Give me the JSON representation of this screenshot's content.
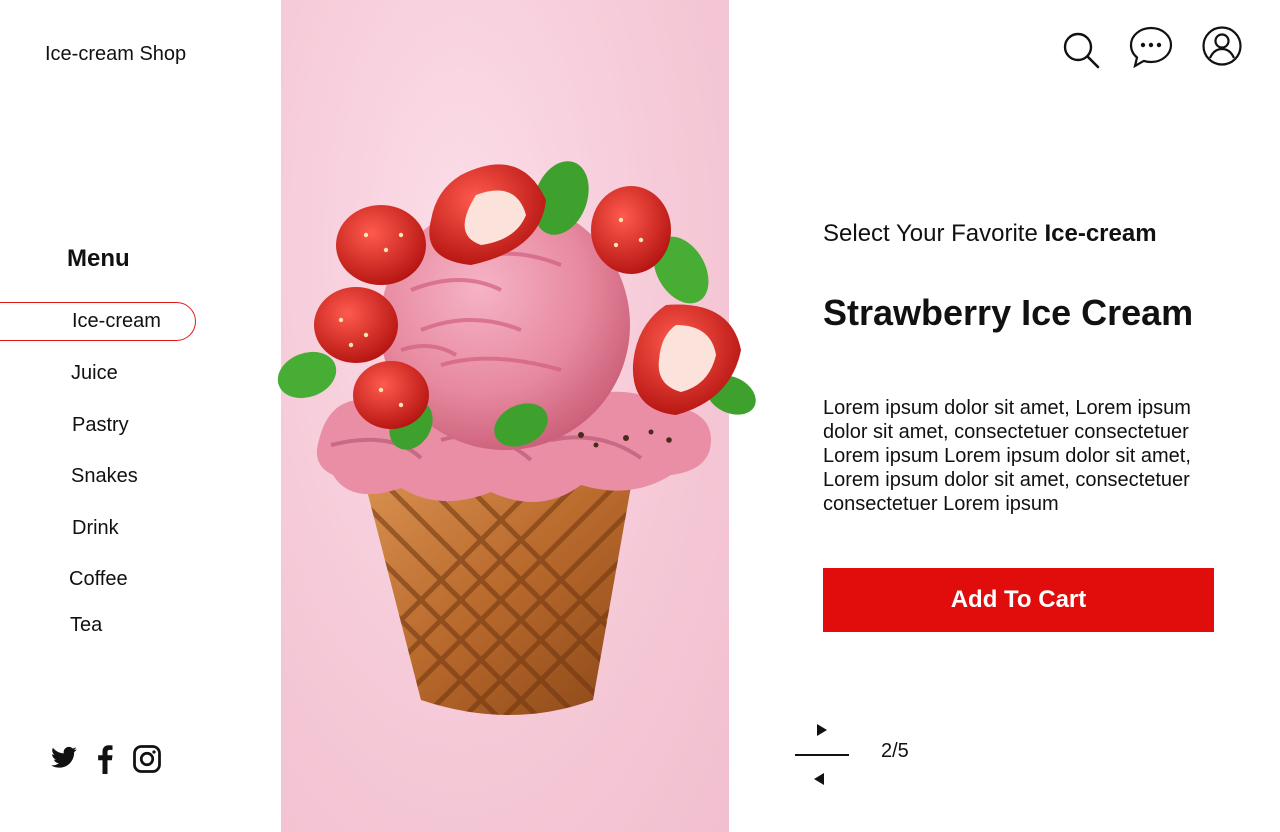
{
  "brand": {
    "name": "Ice-cream Shop"
  },
  "menu": {
    "title": "Menu",
    "items": [
      {
        "label": "Ice-cream",
        "active": true
      },
      {
        "label": "Juice"
      },
      {
        "label": "Pastry"
      },
      {
        "label": "Snakes"
      },
      {
        "label": "Drink"
      },
      {
        "label": "Coffee"
      },
      {
        "label": "Tea"
      }
    ]
  },
  "social": [
    "twitter-icon",
    "facebook-icon",
    "instagram-icon"
  ],
  "header_icons": [
    "search-icon",
    "chat-icon",
    "user-icon"
  ],
  "product": {
    "subtitle_prefix": "Select Your Favorite ",
    "subtitle_bold": "Ice-cream",
    "name": "Strawberry Ice Cream",
    "description": "Lorem ipsum dolor sit amet, Lorem ipsum dolor sit amet, consectetuer consectetuer Lorem ipsum Lorem ipsum dolor sit amet, Lorem ipsum dolor sit amet, consectetuer  consectetuer Lorem ipsum",
    "cart_label": "Add To Cart"
  },
  "pager": {
    "text": "2/5"
  },
  "colors": {
    "accent": "#e10d0d",
    "hero_bg": "#f6cad8"
  }
}
